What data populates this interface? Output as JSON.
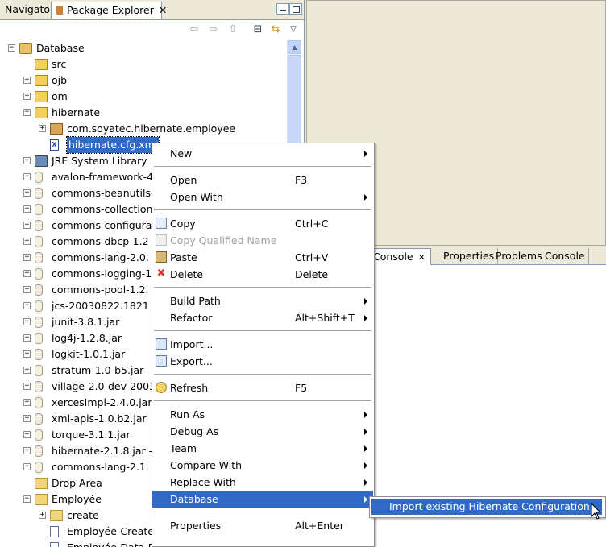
{
  "views": {
    "navigator_tab": "Navigator",
    "package_explorer_tab": "Package Explorer",
    "close_glyph": "✕"
  },
  "tree": [
    {
      "label": "Database",
      "depth": 0,
      "expander": "−",
      "icon": "project-icon"
    },
    {
      "label": "src",
      "depth": 1,
      "expander": "",
      "icon": "source-folder-icon"
    },
    {
      "label": "ojb",
      "depth": 1,
      "expander": "+",
      "icon": "source-folder-icon"
    },
    {
      "label": "om",
      "depth": 1,
      "expander": "+",
      "icon": "source-folder-icon"
    },
    {
      "label": "hibernate",
      "depth": 1,
      "expander": "−",
      "icon": "source-folder-icon"
    },
    {
      "label": "com.soyatec.hibernate.employee",
      "depth": 2,
      "expander": "+",
      "icon": "package-icon"
    },
    {
      "label": "hibernate.cfg.xml",
      "depth": 2,
      "expander": "",
      "icon": "xml-file-icon",
      "selected": true
    },
    {
      "label": "JRE System Library",
      "depth": 1,
      "expander": "+",
      "icon": "library-icon"
    },
    {
      "label": "avalon-framework-4",
      "depth": 1,
      "expander": "+",
      "icon": "jar-icon"
    },
    {
      "label": "commons-beanutils-",
      "depth": 1,
      "expander": "+",
      "icon": "jar-icon"
    },
    {
      "label": "commons-collection",
      "depth": 1,
      "expander": "+",
      "icon": "jar-icon"
    },
    {
      "label": "commons-configura",
      "depth": 1,
      "expander": "+",
      "icon": "jar-icon"
    },
    {
      "label": "commons-dbcp-1.2",
      "depth": 1,
      "expander": "+",
      "icon": "jar-icon"
    },
    {
      "label": "commons-lang-2.0.",
      "depth": 1,
      "expander": "+",
      "icon": "jar-icon"
    },
    {
      "label": "commons-logging-1",
      "depth": 1,
      "expander": "+",
      "icon": "jar-icon"
    },
    {
      "label": "commons-pool-1.2.",
      "depth": 1,
      "expander": "+",
      "icon": "jar-icon"
    },
    {
      "label": "jcs-20030822.1821",
      "depth": 1,
      "expander": "+",
      "icon": "jar-icon"
    },
    {
      "label": "junit-3.8.1.jar",
      "depth": 1,
      "expander": "+",
      "icon": "jar-icon"
    },
    {
      "label": "log4j-1.2.8.jar",
      "depth": 1,
      "expander": "+",
      "icon": "jar-icon"
    },
    {
      "label": "logkit-1.0.1.jar",
      "depth": 1,
      "expander": "+",
      "icon": "jar-icon"
    },
    {
      "label": "stratum-1.0-b5.jar",
      "depth": 1,
      "expander": "+",
      "icon": "jar-icon"
    },
    {
      "label": "village-2.0-dev-2003",
      "depth": 1,
      "expander": "+",
      "icon": "jar-icon"
    },
    {
      "label": "xercesImpl-2.4.0.jar",
      "depth": 1,
      "expander": "+",
      "icon": "jar-icon"
    },
    {
      "label": "xml-apis-1.0.b2.jar",
      "depth": 1,
      "expander": "+",
      "icon": "jar-icon"
    },
    {
      "label": "torque-3.1.1.jar",
      "depth": 1,
      "expander": "+",
      "icon": "jar-icon"
    },
    {
      "label": "hibernate-2.1.8.jar -",
      "depth": 1,
      "expander": "+",
      "icon": "jar-icon"
    },
    {
      "label": "commons-lang-2.1.",
      "depth": 1,
      "expander": "+",
      "icon": "jar-icon"
    },
    {
      "label": "Drop Area",
      "depth": 1,
      "expander": "",
      "icon": "folder-icon"
    },
    {
      "label": "Employée",
      "depth": 1,
      "expander": "−",
      "icon": "folder-icon"
    },
    {
      "label": "create",
      "depth": 2,
      "expander": "+",
      "icon": "folder-icon"
    },
    {
      "label": "Employée-Create",
      "depth": 2,
      "expander": "",
      "icon": "file-icon"
    },
    {
      "label": "Employée-Data-Diagram",
      "depth": 2,
      "expander": "",
      "icon": "file-icon"
    }
  ],
  "bottom_tabs": {
    "console_active": "Console",
    "properties": "Properties",
    "problems": "Problems",
    "console": "Console"
  },
  "context_menu": [
    {
      "type": "item",
      "label": "New",
      "accel": "",
      "submenu": true
    },
    {
      "type": "sep"
    },
    {
      "type": "item",
      "label": "Open",
      "accel": "F3"
    },
    {
      "type": "item",
      "label": "Open With",
      "accel": "",
      "submenu": true
    },
    {
      "type": "sep"
    },
    {
      "type": "item",
      "label": "Copy",
      "accel": "Ctrl+C",
      "icon": "copy-icon"
    },
    {
      "type": "item",
      "label": "Copy Qualified Name",
      "accel": "",
      "disabled": true,
      "icon": "copy-qualified-name-icon"
    },
    {
      "type": "item",
      "label": "Paste",
      "accel": "Ctrl+V",
      "icon": "paste-icon"
    },
    {
      "type": "item",
      "label": "Delete",
      "accel": "Delete",
      "icon": "delete-icon"
    },
    {
      "type": "sep"
    },
    {
      "type": "item",
      "label": "Build Path",
      "accel": "",
      "submenu": true
    },
    {
      "type": "item",
      "label": "Refactor",
      "accel": "Alt+Shift+T",
      "submenu": true
    },
    {
      "type": "sep"
    },
    {
      "type": "item",
      "label": "Import...",
      "accel": "",
      "icon": "import-icon"
    },
    {
      "type": "item",
      "label": "Export...",
      "accel": "",
      "icon": "export-icon"
    },
    {
      "type": "sep"
    },
    {
      "type": "item",
      "label": "Refresh",
      "accel": "F5",
      "icon": "refresh-icon"
    },
    {
      "type": "sep"
    },
    {
      "type": "item",
      "label": "Run As",
      "accel": "",
      "submenu": true
    },
    {
      "type": "item",
      "label": "Debug As",
      "accel": "",
      "submenu": true
    },
    {
      "type": "item",
      "label": "Team",
      "accel": "",
      "submenu": true
    },
    {
      "type": "item",
      "label": "Compare With",
      "accel": "",
      "submenu": true
    },
    {
      "type": "item",
      "label": "Replace With",
      "accel": "",
      "submenu": true
    },
    {
      "type": "item",
      "label": "Database",
      "accel": "",
      "submenu": true,
      "highlighted": true
    },
    {
      "type": "sep"
    },
    {
      "type": "item",
      "label": "Properties",
      "accel": "Alt+Enter"
    }
  ],
  "submenu": {
    "item_label": "Import existing Hibernate Configuration"
  },
  "colors": {
    "selection": "#316ac5",
    "chrome": "#ece9d8",
    "border": "#7f9db9",
    "delete_red": "#d9342b"
  }
}
